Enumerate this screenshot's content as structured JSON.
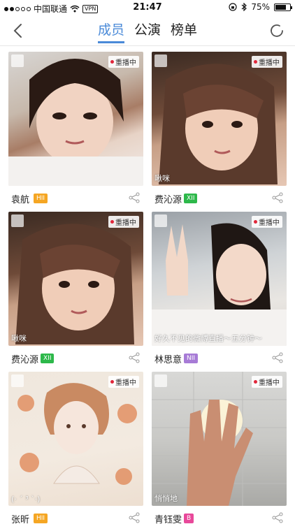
{
  "status_bar": {
    "carrier": "中国联通",
    "vpn": "VPN",
    "time": "21:47",
    "battery": "75%",
    "battery_level": 0.75
  },
  "nav": {
    "tabs": [
      "成员",
      "公演",
      "榜单"
    ],
    "active_tab": 0
  },
  "accent_color": "#4a8ad8",
  "members": [
    {
      "name": "袁航",
      "team": "HII",
      "team_color": "#f5a623",
      "live_label": "重播中",
      "caption": ""
    },
    {
      "name": "费沁源",
      "team": "XII",
      "team_color": "#2db84a",
      "live_label": "重播中",
      "caption": "啾咪"
    },
    {
      "name": "费沁源",
      "team": "XII",
      "team_color": "#2db84a",
      "live_label": "重播中",
      "caption": "啾咪"
    },
    {
      "name": "林思意",
      "team": "NII",
      "team_color": "#a77bd6",
      "live_label": "重播中",
      "caption": "好久不见的微博直播～五分钟～"
    },
    {
      "name": "张昕",
      "team": "HII",
      "team_color": "#f5a623",
      "live_label": "重播中",
      "caption": "(· ´ ³ `·)"
    },
    {
      "name": "青钰雯",
      "team": "B",
      "team_color": "#e8489a",
      "live_label": "重播中",
      "caption": "悄悄地"
    }
  ]
}
